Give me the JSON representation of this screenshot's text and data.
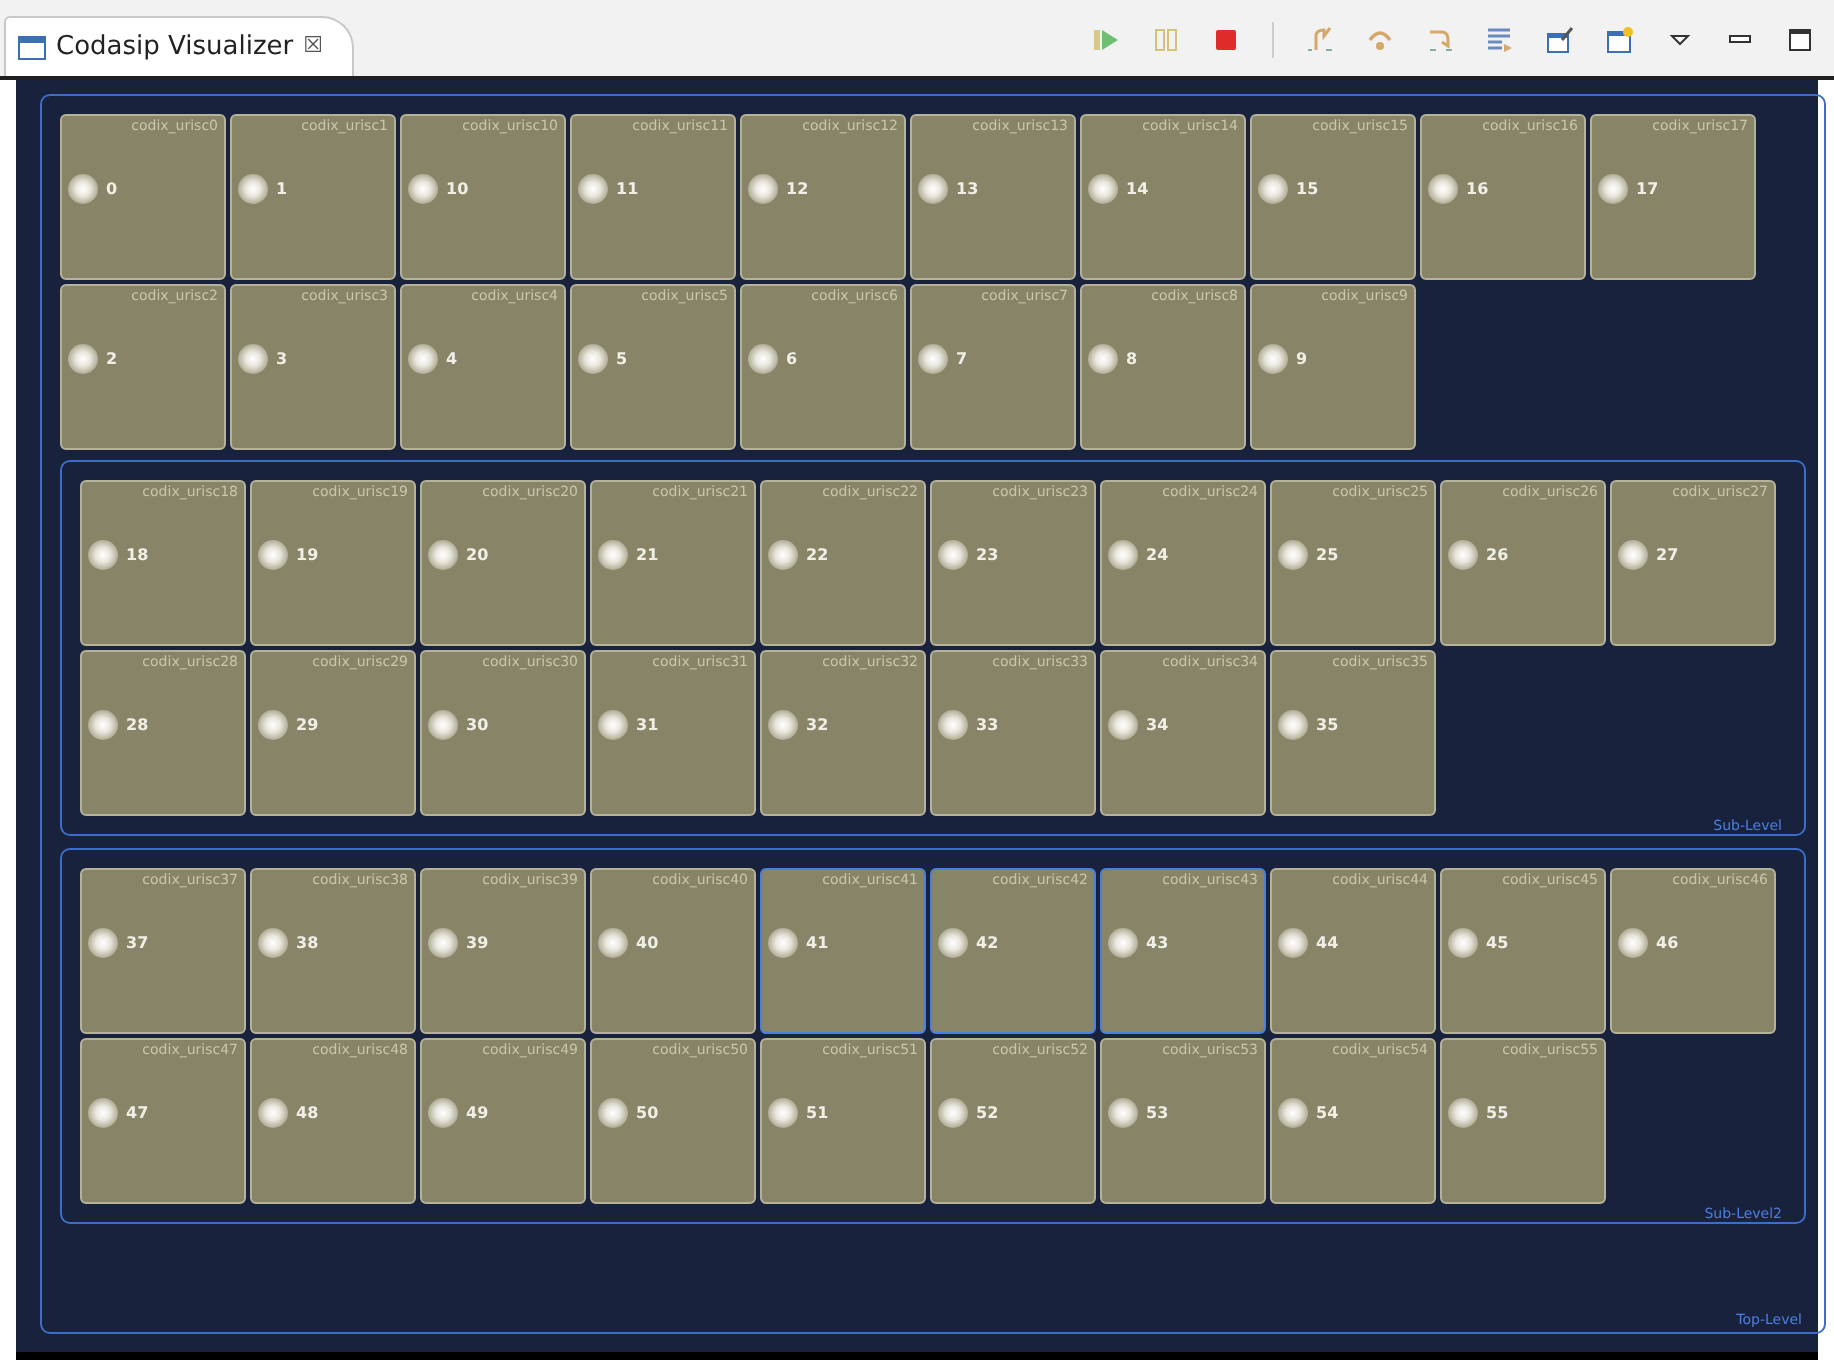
{
  "tab": {
    "title": "Codasip Visualizer",
    "close": "☒"
  },
  "top_level": {
    "label": "Top-Level",
    "cores": [
      {
        "name": "codix_urisc0",
        "number": "0",
        "selected": false
      },
      {
        "name": "codix_urisc1",
        "number": "1",
        "selected": false
      },
      {
        "name": "codix_urisc10",
        "number": "10",
        "selected": false
      },
      {
        "name": "codix_urisc11",
        "number": "11",
        "selected": false
      },
      {
        "name": "codix_urisc12",
        "number": "12",
        "selected": false
      },
      {
        "name": "codix_urisc13",
        "number": "13",
        "selected": false
      },
      {
        "name": "codix_urisc14",
        "number": "14",
        "selected": false
      },
      {
        "name": "codix_urisc15",
        "number": "15",
        "selected": false
      },
      {
        "name": "codix_urisc16",
        "number": "16",
        "selected": false
      },
      {
        "name": "codix_urisc17",
        "number": "17",
        "selected": false
      },
      {
        "name": "codix_urisc2",
        "number": "2",
        "selected": false
      },
      {
        "name": "codix_urisc3",
        "number": "3",
        "selected": false
      },
      {
        "name": "codix_urisc4",
        "number": "4",
        "selected": false
      },
      {
        "name": "codix_urisc5",
        "number": "5",
        "selected": false
      },
      {
        "name": "codix_urisc6",
        "number": "6",
        "selected": false
      },
      {
        "name": "codix_urisc7",
        "number": "7",
        "selected": false
      },
      {
        "name": "codix_urisc8",
        "number": "8",
        "selected": false
      },
      {
        "name": "codix_urisc9",
        "number": "9",
        "selected": false
      }
    ],
    "children": [
      {
        "label": "Sub-Level",
        "cores": [
          {
            "name": "codix_urisc18",
            "number": "18",
            "selected": false
          },
          {
            "name": "codix_urisc19",
            "number": "19",
            "selected": false
          },
          {
            "name": "codix_urisc20",
            "number": "20",
            "selected": false
          },
          {
            "name": "codix_urisc21",
            "number": "21",
            "selected": false
          },
          {
            "name": "codix_urisc22",
            "number": "22",
            "selected": false
          },
          {
            "name": "codix_urisc23",
            "number": "23",
            "selected": false
          },
          {
            "name": "codix_urisc24",
            "number": "24",
            "selected": false
          },
          {
            "name": "codix_urisc25",
            "number": "25",
            "selected": false
          },
          {
            "name": "codix_urisc26",
            "number": "26",
            "selected": false
          },
          {
            "name": "codix_urisc27",
            "number": "27",
            "selected": false
          },
          {
            "name": "codix_urisc28",
            "number": "28",
            "selected": false
          },
          {
            "name": "codix_urisc29",
            "number": "29",
            "selected": false
          },
          {
            "name": "codix_urisc30",
            "number": "30",
            "selected": false
          },
          {
            "name": "codix_urisc31",
            "number": "31",
            "selected": false
          },
          {
            "name": "codix_urisc32",
            "number": "32",
            "selected": false
          },
          {
            "name": "codix_urisc33",
            "number": "33",
            "selected": false
          },
          {
            "name": "codix_urisc34",
            "number": "34",
            "selected": false
          },
          {
            "name": "codix_urisc35",
            "number": "35",
            "selected": false
          }
        ]
      },
      {
        "label": "Sub-Level2",
        "cores": [
          {
            "name": "codix_urisc37",
            "number": "37",
            "selected": false
          },
          {
            "name": "codix_urisc38",
            "number": "38",
            "selected": false
          },
          {
            "name": "codix_urisc39",
            "number": "39",
            "selected": false
          },
          {
            "name": "codix_urisc40",
            "number": "40",
            "selected": false
          },
          {
            "name": "codix_urisc41",
            "number": "41",
            "selected": true
          },
          {
            "name": "codix_urisc42",
            "number": "42",
            "selected": true
          },
          {
            "name": "codix_urisc43",
            "number": "43",
            "selected": true
          },
          {
            "name": "codix_urisc44",
            "number": "44",
            "selected": false
          },
          {
            "name": "codix_urisc45",
            "number": "45",
            "selected": false
          },
          {
            "name": "codix_urisc46",
            "number": "46",
            "selected": false
          },
          {
            "name": "codix_urisc47",
            "number": "47",
            "selected": false
          },
          {
            "name": "codix_urisc48",
            "number": "48",
            "selected": false
          },
          {
            "name": "codix_urisc49",
            "number": "49",
            "selected": false
          },
          {
            "name": "codix_urisc50",
            "number": "50",
            "selected": false
          },
          {
            "name": "codix_urisc51",
            "number": "51",
            "selected": false
          },
          {
            "name": "codix_urisc52",
            "number": "52",
            "selected": false
          },
          {
            "name": "codix_urisc53",
            "number": "53",
            "selected": false
          },
          {
            "name": "codix_urisc54",
            "number": "54",
            "selected": false
          },
          {
            "name": "codix_urisc55",
            "number": "55",
            "selected": false
          }
        ]
      }
    ]
  }
}
